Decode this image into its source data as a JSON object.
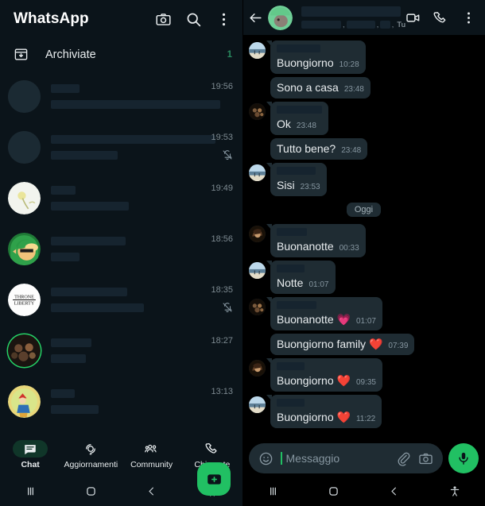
{
  "app": {
    "title": "WhatsApp"
  },
  "left_header": {
    "icons": [
      "camera-icon",
      "search-icon",
      "overflow-menu-icon"
    ]
  },
  "archived": {
    "icon": "archive-box-icon",
    "label": "Archiviate",
    "count": "1"
  },
  "chat_list": [
    {
      "avatar": "blank",
      "name_w": 36,
      "msg_w": 213,
      "time": "19:56",
      "muted": false,
      "ring": false
    },
    {
      "avatar": "blank",
      "name_w": 207,
      "msg_w": 84,
      "time": "19:53",
      "muted": true,
      "ring": false
    },
    {
      "avatar": "flower",
      "name_w": 31,
      "msg_w": 98,
      "time": "19:49",
      "muted": false,
      "ring": false
    },
    {
      "avatar": "link",
      "name_w": 94,
      "msg_w": 36,
      "time": "18:56",
      "muted": false,
      "ring": false
    },
    {
      "avatar": "throne",
      "name_w": 96,
      "msg_w": 117,
      "time": "18:35",
      "muted": true,
      "ring": false
    },
    {
      "avatar": "group-dark",
      "name_w": 51,
      "msg_w": 44,
      "time": "18:27",
      "muted": false,
      "ring": true
    },
    {
      "avatar": "gnome",
      "name_w": 30,
      "msg_w": 60,
      "time": "13:13",
      "muted": false,
      "ring": false
    },
    {
      "avatar": "hamster",
      "name_w": 72,
      "msg_w": 174,
      "time": "",
      "muted": false,
      "ring": false
    }
  ],
  "fab": {
    "icon": "new-chat-icon"
  },
  "bottom_nav": [
    {
      "icon": "chat-icon",
      "label": "Chat",
      "active": true
    },
    {
      "icon": "updates-icon",
      "label": "Aggiornamenti",
      "active": false
    },
    {
      "icon": "community-icon",
      "label": "Community",
      "active": false
    },
    {
      "icon": "calls-icon",
      "label": "Chiamate",
      "active": false
    }
  ],
  "conversation": {
    "back_icon": "back-arrow-icon",
    "avatar": "hamster",
    "name_redacted_width": 125,
    "subtitle_segments": [
      72,
      52,
      18
    ],
    "subtitle_tail": ", Tu",
    "icons": [
      "video-call-icon",
      "voice-call-icon",
      "overflow-menu-icon"
    ]
  },
  "date_divider": {
    "label": "Oggi"
  },
  "messages": [
    {
      "avatar": "beach",
      "show_avatar": true,
      "tail": true,
      "sender_w": 55,
      "text": "Buongiorno",
      "time": "10:28"
    },
    {
      "avatar": "beach",
      "show_avatar": false,
      "tail": false,
      "sender_w": 0,
      "text": "Sono a casa",
      "time": "23:48"
    },
    {
      "avatar": "dark",
      "show_avatar": true,
      "tail": true,
      "sender_w": 57,
      "text": "Ok",
      "time": "23:48"
    },
    {
      "avatar": "dark",
      "show_avatar": false,
      "tail": false,
      "sender_w": 0,
      "text": "Tutto bene?",
      "time": "23:48"
    },
    {
      "avatar": "beach",
      "show_avatar": true,
      "tail": true,
      "sender_w": 49,
      "text": "Sisi",
      "time": "23:53"
    },
    {
      "divider": true,
      "label": "Oggi"
    },
    {
      "avatar": "brown",
      "show_avatar": true,
      "tail": true,
      "sender_w": 38,
      "text": "Buonanotte",
      "time": "00:33"
    },
    {
      "avatar": "beach",
      "show_avatar": true,
      "tail": true,
      "sender_w": 35,
      "text": "Notte",
      "time": "01:07"
    },
    {
      "avatar": "dark",
      "show_avatar": true,
      "tail": true,
      "sender_w": 50,
      "text": "Buonanotte 💗",
      "time": "01:07"
    },
    {
      "avatar": "dark",
      "show_avatar": false,
      "tail": false,
      "sender_w": 0,
      "text": "Buongiorno family ❤️",
      "time": "07:39"
    },
    {
      "avatar": "brown",
      "show_avatar": true,
      "tail": true,
      "sender_w": 35,
      "text": "Buongiorno ❤️",
      "time": "09:35"
    },
    {
      "avatar": "beach",
      "show_avatar": true,
      "tail": true,
      "sender_w": 35,
      "text": "Buongiorno ❤️",
      "time": "11:22"
    }
  ],
  "input_bar": {
    "emoji_icon": "emoji-smiley-icon",
    "placeholder": "Messaggio",
    "value": "",
    "attach_icon": "paperclip-icon",
    "camera_icon": "camera-icon",
    "mic_icon": "microphone-icon"
  },
  "system_nav": {
    "recents_icon": "recents-icon",
    "home_icon": "home-icon",
    "back_icon": "back-chevron-icon",
    "accessibility_icon": "accessibility-icon"
  },
  "colors": {
    "app_bg": "#0b141a",
    "chat_bg": "#000000",
    "bubble": "#1f2c33",
    "accent_green": "#21c063",
    "redaction": "#16242f",
    "time_text": "#8696a0"
  }
}
